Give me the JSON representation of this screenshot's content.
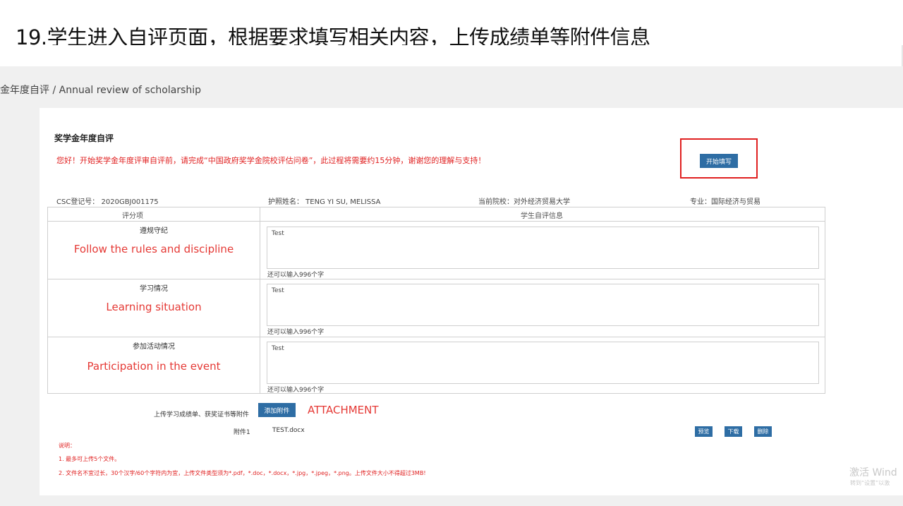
{
  "slide": {
    "title": "19.学生进入自评页面，根据要求填写相关内容，上传成绩单等附件信息"
  },
  "breadcrumb": "金年度自评 / Annual review of scholarship",
  "section": {
    "title": "奖学金年度自评",
    "notice": "您好！开始奖学金年度评审自评前，请完成“中国政府奖学金院校评估问卷”，此过程将需要约15分钟，谢谢您的理解与支持！",
    "start_button": "开始填写"
  },
  "student": {
    "csc": "CSC登记号： 2020GBJ001175",
    "passport_name": "护照姓名： TENG YI SU, MELISSA",
    "school": "当前院校：对外经济贸易大学",
    "major": "专业：国际经济与贸易"
  },
  "table": {
    "headers": [
      "评分项",
      "学生自评信息"
    ],
    "rows": [
      {
        "label": "遵规守纪",
        "annotation": "Follow the rules and discipline",
        "value": "Test",
        "counter": "还可以输入996个字"
      },
      {
        "label": "学习情况",
        "annotation": "Learning situation",
        "value": "Test",
        "counter": "还可以输入996个字"
      },
      {
        "label": "参加活动情况",
        "annotation": "Participation in the event",
        "value": "Test",
        "counter": "还可以输入996个字"
      }
    ]
  },
  "upload": {
    "label": "上传学习成绩单、获奖证书等附件",
    "button": "添加附件",
    "annotation": "ATTACHMENT",
    "file_label": "附件1",
    "file_name": "TEST.docx",
    "actions": [
      "预览",
      "下载",
      "删除"
    ]
  },
  "notes": {
    "heading": "说明：",
    "items": [
      "1. 最多可上传5个文件。",
      "2. 文件名不宜过长，30个汉字/60个字符内为宜，上传文件类型须为*.pdf，*.doc，*.docx，*.jpg，*.jpeg，*.png。上传文件大小不得超过3MB!"
    ]
  },
  "watermark": {
    "line1": "激活 Wind",
    "line2": "转到“设置”以激"
  },
  "colors": {
    "primary": "#2e6da4",
    "alert": "#e02020"
  }
}
